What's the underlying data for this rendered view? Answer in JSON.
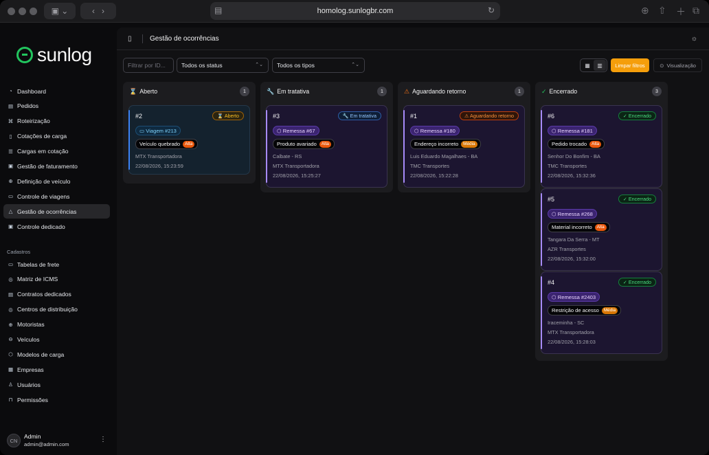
{
  "browser": {
    "url": "homolog.sunlogbr.com"
  },
  "app": {
    "brand": "sunlog",
    "page_title": "Gestão de ocorrências"
  },
  "sidebar": {
    "items": [
      {
        "label": "Dashboard",
        "icon": "dashboard-icon",
        "glyph": "◔"
      },
      {
        "label": "Pedidos",
        "icon": "clipboard-icon",
        "glyph": "▤"
      },
      {
        "label": "Roteirização",
        "icon": "route-icon",
        "glyph": "⌘"
      },
      {
        "label": "Cotações de carga",
        "icon": "file-icon",
        "glyph": "▯"
      },
      {
        "label": "Cargas em cotação",
        "icon": "list-icon",
        "glyph": "☰"
      },
      {
        "label": "Gestão de faturamento",
        "icon": "receipt-icon",
        "glyph": "▣"
      },
      {
        "label": "Definição de veículo",
        "icon": "wheel-icon",
        "glyph": "⊕"
      },
      {
        "label": "Controle de viagens",
        "icon": "truck-icon",
        "glyph": "▭"
      },
      {
        "label": "Gestão de ocorrências",
        "icon": "alert-triangle-icon",
        "glyph": "△"
      },
      {
        "label": "Controle dedicado",
        "icon": "clipboard-check-icon",
        "glyph": "▣"
      }
    ],
    "section_label": "Cadastros",
    "cadastros": [
      {
        "label": "Tabelas de frete",
        "icon": "truck-icon",
        "glyph": "▭"
      },
      {
        "label": "Matriz de ICMS",
        "icon": "map-pin-icon",
        "glyph": "◎"
      },
      {
        "label": "Contratos dedicados",
        "icon": "contract-icon",
        "glyph": "▤"
      },
      {
        "label": "Centros de distribuição",
        "icon": "map-pin-icon",
        "glyph": "◎"
      },
      {
        "label": "Motoristas",
        "icon": "steering-wheel-icon",
        "glyph": "⊕"
      },
      {
        "label": "Veículos",
        "icon": "car-icon",
        "glyph": "⊖"
      },
      {
        "label": "Modelos de carga",
        "icon": "box-icon",
        "glyph": "⬡"
      },
      {
        "label": "Empresas",
        "icon": "building-icon",
        "glyph": "▦"
      },
      {
        "label": "Usuários",
        "icon": "users-icon",
        "glyph": "♙"
      },
      {
        "label": "Permissões",
        "icon": "lock-icon",
        "glyph": "⊓"
      }
    ],
    "user": {
      "initials": "CN",
      "name": "Admin",
      "email": "admin@admin.com"
    }
  },
  "filters": {
    "id_placeholder": "Filtrar por ID...",
    "status_value": "Todos os status",
    "type_value": "Todos os tipos",
    "clear_label": "Limpar filtros",
    "view_label": "Visualização"
  },
  "columns": [
    {
      "title": "Aberto",
      "count": "1",
      "icon": "hourglass-icon",
      "glyph": "⌛",
      "color": "#f59e0b",
      "cards": [
        {
          "num": "#2",
          "status": "Aberto",
          "status_glyph": "⌛",
          "ref": "Viagem #213",
          "ref_glyph": "▭",
          "reason": "Veículo quebrado",
          "priority": "Alta",
          "location": "MTX Transportadora",
          "carrier": "",
          "datetime": "22/08/2026, 15:23:59"
        }
      ]
    },
    {
      "title": "Em tratativa",
      "count": "1",
      "icon": "wrench-icon",
      "glyph": "🔧",
      "color": "#60a5fa",
      "cards": [
        {
          "num": "#3",
          "status": "Em tratativa",
          "status_glyph": "🔧",
          "ref": "Remessa #67",
          "ref_glyph": "⬡",
          "reason": "Produto avariado",
          "priority": "Alta",
          "location": "Calbate - RS",
          "carrier": "MTX Transportadora",
          "datetime": "22/08/2026, 15:25:27"
        }
      ]
    },
    {
      "title": "Aguardando retorno",
      "count": "1",
      "icon": "alert-triangle-icon",
      "glyph": "⚠",
      "color": "#f97316",
      "cards": [
        {
          "num": "#1",
          "status": "Aguardando retorno",
          "status_glyph": "⚠",
          "ref": "Remessa #180",
          "ref_glyph": "⬡",
          "reason": "Endereço incorreto",
          "priority": "Média",
          "location": "Luis Eduardo Magalhaes - BA",
          "carrier": "TMC Transportes",
          "datetime": "22/08/2026, 15:22:28"
        }
      ]
    },
    {
      "title": "Encerrado",
      "count": "3",
      "icon": "check-circle-icon",
      "glyph": "✓",
      "color": "#22c55e",
      "cards": [
        {
          "num": "#6",
          "status": "Encerrado",
          "status_glyph": "✓",
          "ref": "Remessa #181",
          "ref_glyph": "⬡",
          "reason": "Pedido trocado",
          "priority": "Alta",
          "location": "Senhor Do Bonfim - BA",
          "carrier": "TMC Transportes",
          "datetime": "22/08/2026, 15:32:36"
        },
        {
          "num": "#5",
          "status": "Encerrado",
          "status_glyph": "✓",
          "ref": "Remessa #268",
          "ref_glyph": "⬡",
          "reason": "Material incorreto",
          "priority": "Alta",
          "location": "Tangara Da Serra - MT",
          "carrier": "AZR Transportes",
          "datetime": "22/08/2026, 15:32:00"
        },
        {
          "num": "#4",
          "status": "Encerrado",
          "status_glyph": "✓",
          "ref": "Remessa #2403",
          "ref_glyph": "⬡",
          "reason": "Restrição de acesso",
          "priority": "Média",
          "location": "Iraceminha - SC",
          "carrier": "MTX Transportadora",
          "datetime": "22/08/2026, 15:28:03"
        }
      ]
    }
  ]
}
